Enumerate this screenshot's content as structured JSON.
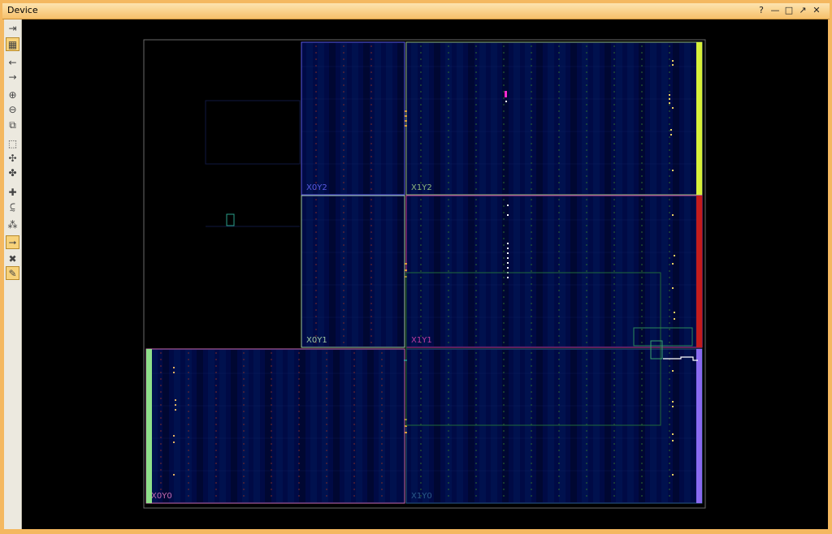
{
  "window": {
    "title": "Device",
    "controls": {
      "help": "?",
      "minimize": "—",
      "restore": "□",
      "float": "↗",
      "close": "✕"
    }
  },
  "toolbar": {
    "buttons": [
      {
        "name": "collapse-icon",
        "glyph": "⇥"
      },
      {
        "name": "device-view-icon",
        "glyph": "▦",
        "active": true
      },
      {
        "name": "back-icon",
        "glyph": "←"
      },
      {
        "name": "forward-icon",
        "glyph": "→"
      },
      {
        "name": "zoom-in-icon",
        "glyph": "⊕"
      },
      {
        "name": "zoom-out-icon",
        "glyph": "⊖"
      },
      {
        "name": "zoom-fit-icon",
        "glyph": "⧉"
      },
      {
        "name": "select-area-icon",
        "glyph": "⬚"
      },
      {
        "name": "autofit-selection-icon",
        "glyph": "✣"
      },
      {
        "name": "route-icon",
        "glyph": "✤"
      },
      {
        "name": "create-pblock-icon",
        "glyph": "✚"
      },
      {
        "name": "place-ports-icon",
        "glyph": "⫇"
      },
      {
        "name": "site-pin-icon",
        "glyph": "⁂"
      },
      {
        "name": "show-routing-icon",
        "glyph": "⭢",
        "active": true
      },
      {
        "name": "unplace-icon",
        "glyph": "✖"
      },
      {
        "name": "highlight-icon",
        "glyph": "✎",
        "active": true
      }
    ]
  },
  "clock_regions": [
    {
      "label": "X0Y2",
      "color": "#5a5ae0"
    },
    {
      "label": "X1Y2",
      "color": "#8fb87a"
    },
    {
      "label": "X0Y1",
      "color": "#a0c8a0"
    },
    {
      "label": "X1Y1",
      "color": "#c03aa0"
    },
    {
      "label": "X0Y0",
      "color": "#c86ab0"
    },
    {
      "label": "X1Y0",
      "color": "#2a5a88"
    }
  ],
  "colors": {
    "io_bank_top": "#d8f03a",
    "io_bank_mid": "#c41c1c",
    "io_bank_bottom": "#8a6af0",
    "io_bank_left": "#8fe08a",
    "fabric": "#000a45"
  }
}
